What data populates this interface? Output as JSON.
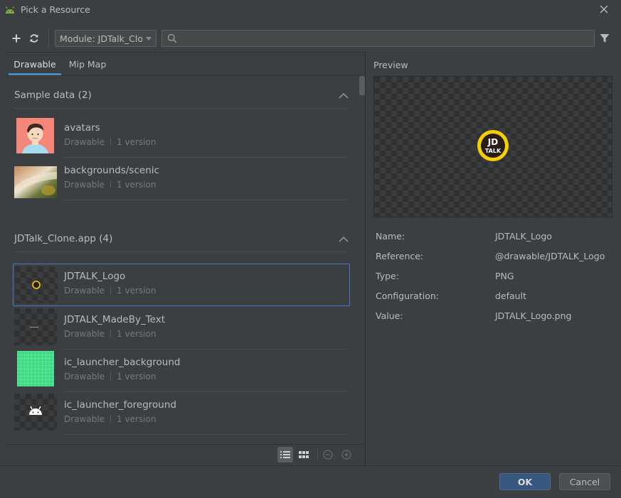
{
  "window": {
    "title": "Pick a Resource",
    "icon": "android-icon"
  },
  "toolbar": {
    "add_icon": "plus-icon",
    "refresh_icon": "refresh-icon",
    "module_value": "Module: JDTalk_Clone",
    "search_value": "",
    "filter_icon": "filter-icon"
  },
  "tabs": [
    {
      "label": "Drawable",
      "selected": true
    },
    {
      "label": "Mip Map",
      "selected": false
    }
  ],
  "sections": [
    {
      "title": "Sample data (2)",
      "items": [
        {
          "name": "avatars",
          "type": "Drawable",
          "versions": "1 version"
        },
        {
          "name": "backgrounds/scenic",
          "type": "Drawable",
          "versions": "1 version"
        }
      ]
    },
    {
      "title": "JDTalk_Clone.app (4)",
      "items": [
        {
          "name": "JDTALK_Logo",
          "type": "Drawable",
          "versions": "1 version",
          "selected": true
        },
        {
          "name": "JDTALK_MadeBy_Text",
          "type": "Drawable",
          "versions": "1 version"
        },
        {
          "name": "ic_launcher_background",
          "type": "Drawable",
          "versions": "1 version"
        },
        {
          "name": "ic_launcher_foreground",
          "type": "Drawable",
          "versions": "1 version"
        }
      ]
    }
  ],
  "preview": {
    "label": "Preview",
    "logo_text_line1": "JD",
    "logo_text_line2": "TALK",
    "properties": [
      {
        "label": "Name:",
        "value": "JDTALK_Logo"
      },
      {
        "label": "Reference:",
        "value": "@drawable/JDTALK_Logo"
      },
      {
        "label": "Type:",
        "value": "PNG"
      },
      {
        "label": "Configuration:",
        "value": "default"
      },
      {
        "label": "Value:",
        "value": "JDTALK_Logo.png"
      }
    ]
  },
  "footer": {
    "ok_label": "OK",
    "cancel_label": "Cancel"
  },
  "colors": {
    "background": "#3c3f41",
    "accent": "#4a88c7",
    "ok_button": "#365880",
    "logo_yellow": "#f5d000",
    "logo_dark": "#2a1d16"
  }
}
